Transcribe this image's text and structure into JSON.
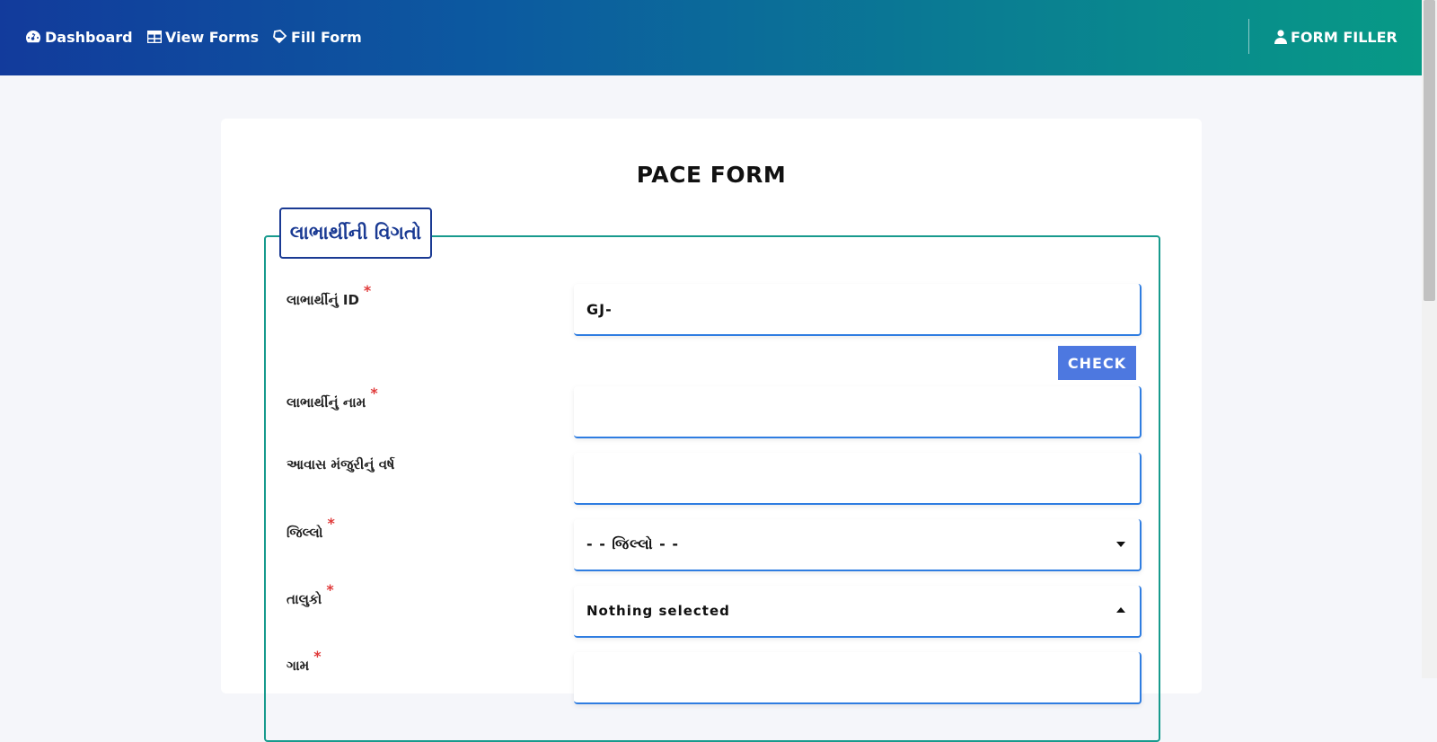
{
  "nav": {
    "dashboard": "Dashboard",
    "view_forms": "View Forms",
    "fill_form": "Fill Form",
    "user": "FORM FILLER"
  },
  "form": {
    "title": "PACE FORM",
    "section_legend": "લાભાર્થીની વિગતો",
    "fields": {
      "beneficiary_id": {
        "label": "લાભાર્થીનું ID",
        "value": "GJ-"
      },
      "beneficiary_name": {
        "label": "લાભાર્થીનું નામ",
        "value": ""
      },
      "approval_year": {
        "label": "આવાસ મંજુરીનું વર્ષ",
        "value": ""
      },
      "district": {
        "label": "જિલ્લો",
        "value": "- - જિલ્લો - -"
      },
      "taluka": {
        "label": "તાલુકો",
        "value": "Nothing selected"
      },
      "village": {
        "label": "ગામ",
        "value": ""
      }
    },
    "check_button": "CHECK",
    "required_mark": "*"
  },
  "colors": {
    "accent": "#4d78e0",
    "legend": "#1a3a93",
    "fieldset_border": "#179a8d",
    "required": "#e03a3a"
  }
}
